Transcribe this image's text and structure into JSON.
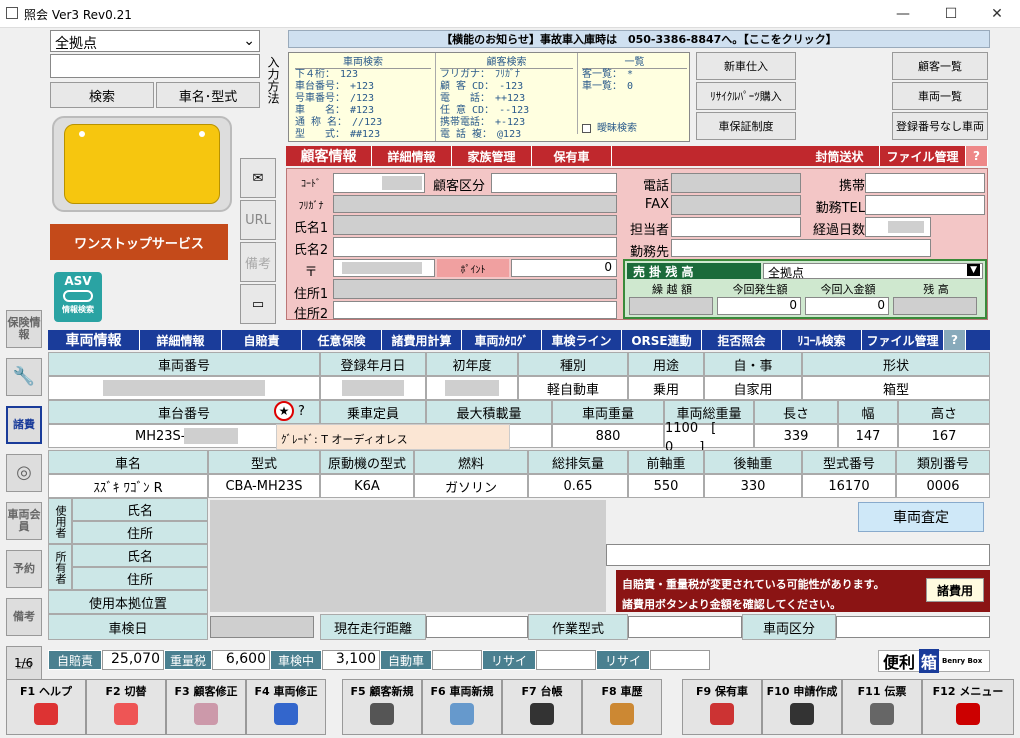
{
  "window": {
    "title": "照会 Ver3 Rev0.21",
    "min": "—",
    "max": "☐",
    "close": "✕"
  },
  "left": {
    "location": "全拠点",
    "search_btn": "検索",
    "car_type_btn": "車名･型式",
    "input_method": "入力方法",
    "onestop": "ワンストップサービス",
    "asv": "ASV",
    "asv_sub": "情報検索",
    "url": "URL",
    "notes": "備考"
  },
  "notice": "【横能のお知らせ】事故車入庫時は　050-3386-8847へ。【ここをクリック】",
  "search_help": {
    "vehicle_title": "車両検索",
    "vehicle_lines": [
      "下４桁：　123",
      "車台番号：　+123",
      "号車番号：　/123",
      "車　　名：　#123",
      "通 称 名：　//123",
      "型　　式：　##123"
    ],
    "customer_title": "顧客検索",
    "customer_lines": [
      "フリガナ：　ﾌﾘｶﾞﾅ",
      "顧 客 CD：　-123",
      "電　　話：　++123",
      "任 意 CD：　--123",
      "携帯電話：　+-123",
      "電 話 複：　@123"
    ],
    "list_title": "一覧",
    "list_lines": [
      "客一覧：　*",
      "車一覧：　0"
    ],
    "fuzzy": "曖昧検索"
  },
  "mid_buttons": [
    "新車仕入",
    "ﾘｻｲｸﾙﾊﾟｰﾂ購入",
    "車保証制度"
  ],
  "right_buttons": [
    "顧客一覧",
    "車両一覧",
    "登録番号なし車両"
  ],
  "customer_tabs": [
    "顧客情報",
    "詳細情報",
    "家族管理",
    "保有車"
  ],
  "customer_tabs_right": [
    "封筒送状",
    "ファイル管理",
    "?"
  ],
  "customer": {
    "code": "ｺｰﾄﾞ",
    "customer_class": "顧客区分",
    "kana": "ﾌﾘｶﾞﾅ",
    "name1": "氏名1",
    "name2": "氏名2",
    "zip": "〒",
    "point": "ﾎﾟｲﾝﾄ",
    "point_val": "0",
    "addr1": "住所1",
    "addr2": "住所2",
    "phone": "電話",
    "fax": "FAX",
    "staff": "担当者",
    "work": "勤務先",
    "mobile": "携帯",
    "work_tel": "勤務TEL",
    "elapsed": "経過日数"
  },
  "receivable": {
    "title": "売 掛 残 高",
    "location": "全拠点",
    "cols": [
      "繰 越 額",
      "今回発生額",
      "今回入金額",
      "残 高"
    ],
    "vals": [
      "",
      "0",
      "0",
      ""
    ]
  },
  "vehicle_tabs": [
    "車両情報",
    "詳細情報",
    "自賠責",
    "任意保険",
    "諸費用計算",
    "車両ｶﾀﾛｸﾞ",
    "車検ライン",
    "ORSE連動",
    "拒否照会",
    "ﾘｺｰﾙ検索",
    "ファイル管理",
    "?"
  ],
  "row1_headers": [
    "車両番号",
    "登録年月日",
    "初年度",
    "種別",
    "用途",
    "自・事",
    "形状"
  ],
  "row1_vals": [
    "",
    "",
    "",
    "軽自動車",
    "乗用",
    "自家用",
    "箱型"
  ],
  "row2_headers": [
    "車台番号",
    "乗車定員",
    "最大積載量",
    "車両重量",
    "車両総重量",
    "長さ",
    "幅",
    "高さ"
  ],
  "row2_vals": [
    "MH23S-",
    "",
    "0　]",
    "880",
    "1100　[　　0　　]",
    "339",
    "147",
    "167"
  ],
  "tooltip": "ｸﾞﾚｰﾄﾞ: T オーディオレス",
  "row3_headers": [
    "車名",
    "型式",
    "原動機の型式",
    "燃料",
    "総排気量",
    "前軸重",
    "後軸重",
    "型式番号",
    "類別番号"
  ],
  "row3_vals": [
    "ｽｽﾞｷ ﾜｺﾞﾝ R",
    "CBA-MH23S",
    "K6A",
    "ガソリン",
    "0.65",
    "550",
    "330",
    "16170",
    "0006"
  ],
  "owner": {
    "user": "使用者",
    "owner": "所有者",
    "name": "氏名",
    "addr": "住所",
    "base": "使用本拠位置",
    "inspection": "車検日",
    "mileage": "現在走行距離",
    "work_type": "作業型式",
    "vehicle_class": "車両区分",
    "assess_btn": "車両査定"
  },
  "warning": {
    "line1": "自賠責・重量税が変更されている可能性があります。",
    "line2": "諸費用ボタンより金額を確認してください。",
    "btn": "諸費用"
  },
  "side_buttons": [
    "保険情報",
    "",
    "諸費",
    "",
    "車両会員",
    "予約",
    "備考",
    ""
  ],
  "page": "1/6",
  "status": [
    {
      "label": "自賠責",
      "val": "25,070"
    },
    {
      "label": "重量税",
      "val": "6,600"
    },
    {
      "label": "車検中",
      "val": "3,100"
    },
    {
      "label": "自動車",
      "val": ""
    },
    {
      "label": "リサイ",
      "val": ""
    },
    {
      "label": "リサイ",
      "val": ""
    }
  ],
  "benri": "便利",
  "benri_box": "箱",
  "benri_sub": "Benry Box",
  "fkeys": [
    "F1 ヘルプ",
    "F2 切替",
    "F3 顧客修正",
    "F4 車両修正",
    "F5 顧客新規",
    "F6 車両新規",
    "F7 台帳",
    "F8 車歴",
    "F9 保有車",
    "F10 申請作成",
    "F11 伝票",
    "F12 メニュー"
  ]
}
